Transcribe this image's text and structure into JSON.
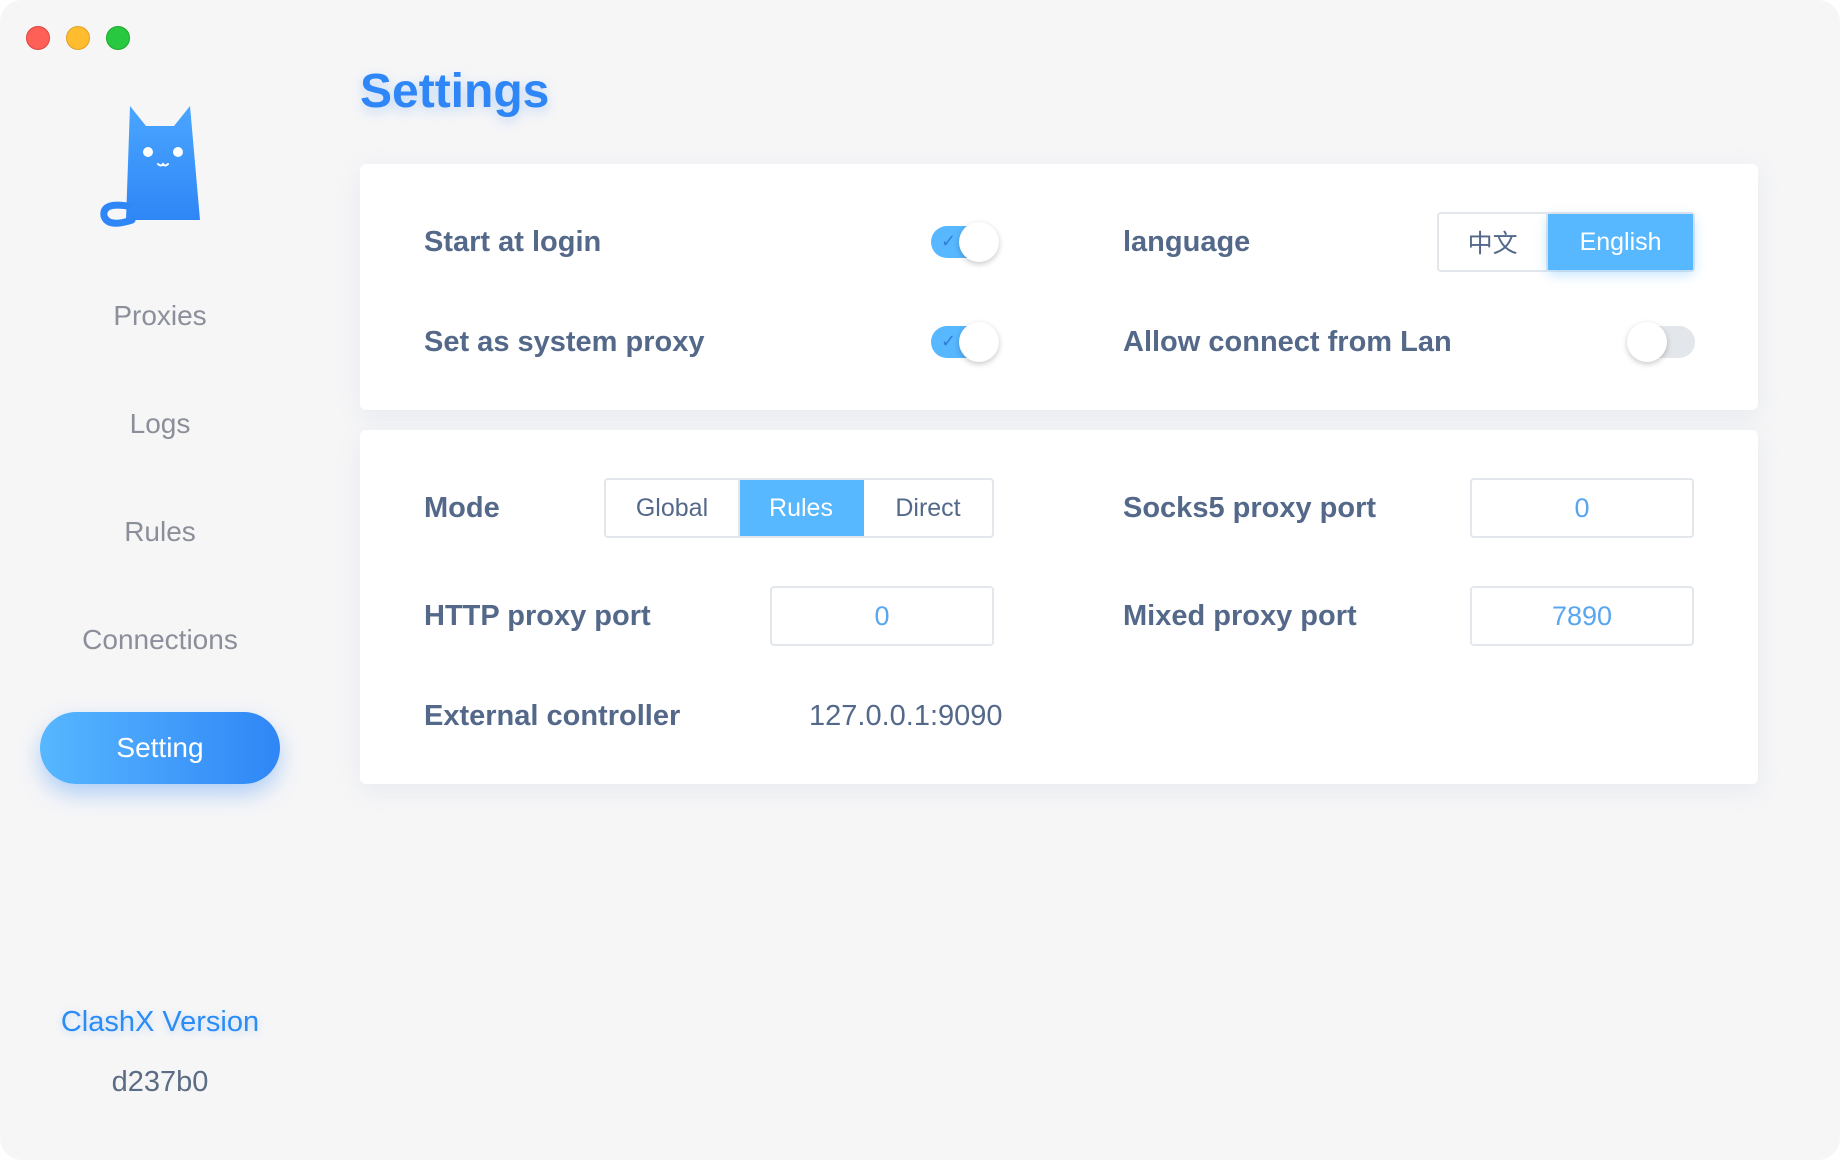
{
  "sidebar": {
    "items": [
      {
        "label": "Proxies"
      },
      {
        "label": "Logs"
      },
      {
        "label": "Rules"
      },
      {
        "label": "Connections"
      },
      {
        "label": "Setting"
      }
    ],
    "active_item": "Setting",
    "version_label": "ClashX Version",
    "version_value": "d237b0"
  },
  "page": {
    "title": "Settings"
  },
  "general": {
    "start_at_login": {
      "label": "Start at login",
      "enabled": true
    },
    "system_proxy": {
      "label": "Set as system proxy",
      "enabled": true
    },
    "language": {
      "label": "language",
      "options": [
        "中文",
        "English"
      ],
      "selected": "English"
    },
    "allow_lan": {
      "label": "Allow connect from Lan",
      "enabled": false
    }
  },
  "proxy": {
    "mode": {
      "label": "Mode",
      "options": [
        "Global",
        "Rules",
        "Direct"
      ],
      "selected": "Rules"
    },
    "http_port": {
      "label": "HTTP proxy port",
      "value": "0"
    },
    "socks5_port": {
      "label": "Socks5 proxy port",
      "value": "0"
    },
    "mixed_port": {
      "label": "Mixed proxy port",
      "value": "7890"
    },
    "external_controller": {
      "label": "External controller",
      "value": "127.0.0.1:9090"
    }
  },
  "colors": {
    "accent": "#2f86f6",
    "accent_light": "#57b7ff",
    "label_text": "#54698a",
    "window_bg": "#f6f6f7"
  },
  "icons": {
    "logo": "cat-logo-icon",
    "toggle_check": "check-icon"
  }
}
